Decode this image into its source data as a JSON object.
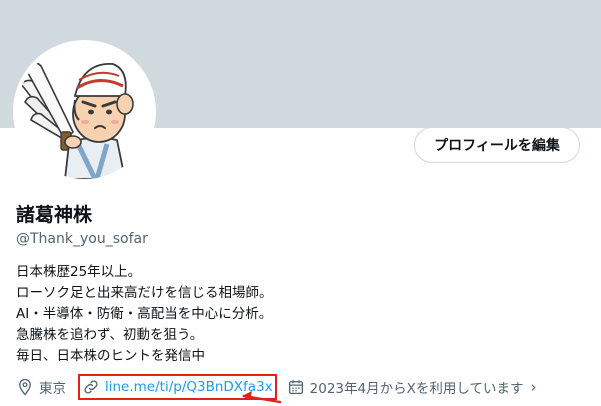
{
  "profile": {
    "display_name": "諸葛神株",
    "handle": "@Thank_you_sofar",
    "edit_button_label": "プロフィールを編集",
    "bio": [
      "日本株歴25年以上。",
      "ローソク足と出来高だけを信じる相場師。",
      "AI・半導体・防衛・高配当を中心に分析。",
      "急騰株を追わず、初動を狙う。",
      "毎日、日本株のヒントを発信中"
    ],
    "location": "東京",
    "link_text": "line.me/ti/p/Q3BnDXfa3x",
    "joined": "2023年4月からXを利用しています"
  },
  "icons": {
    "location": "location-pin-icon",
    "link": "link-icon",
    "calendar": "calendar-icon",
    "chevron": "chevron-right-icon"
  },
  "colors": {
    "banner": "#cfd9de",
    "link": "#1d9bf0",
    "secondary_text": "#536471",
    "highlight": "#e0211e"
  }
}
